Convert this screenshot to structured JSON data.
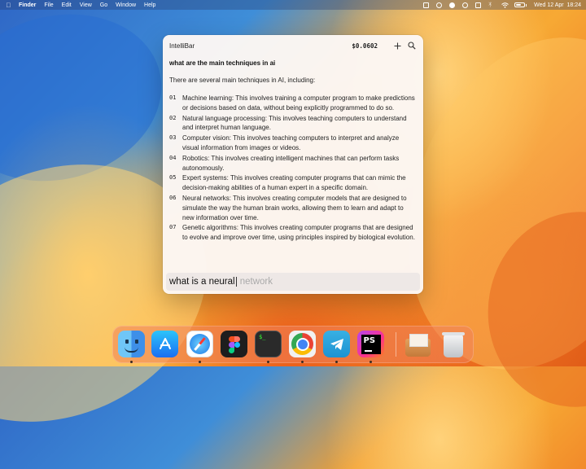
{
  "menubar": {
    "apple_icon": "apple-logo-icon",
    "app_name": "Finder",
    "menus": [
      "File",
      "Edit",
      "View",
      "Go",
      "Window",
      "Help"
    ],
    "status_icons": [
      "dropbox-icon",
      "record-icon",
      "brightness-icon",
      "circle-icon",
      "lock-icon",
      "bluetooth-icon",
      "wifi-icon",
      "battery-icon"
    ],
    "battery_level": 0.7,
    "clock": "Wed 12 Apr  18:24"
  },
  "window": {
    "title": "IntelliBar",
    "cost": "$0.0602",
    "add_icon": "plus-icon",
    "search_icon": "search-icon",
    "question": "what are the main techniques in ai",
    "intro": "There are several main techniques in AI, including:",
    "items": [
      {
        "num": "01",
        "text": "Machine learning: This involves training a computer program to make predictions or decisions based on data, without being explicitly programmed to do so."
      },
      {
        "num": "02",
        "text": "Natural language processing: This involves teaching computers to understand and interpret human language."
      },
      {
        "num": "03",
        "text": "Computer vision: This involves teaching computers to interpret and analyze visual information from images or videos."
      },
      {
        "num": "04",
        "text": "Robotics: This involves creating intelligent machines that can perform tasks autonomously."
      },
      {
        "num": "05",
        "text": "Expert systems: This involves creating computer programs that can mimic the decision-making abilities of a human expert in a specific domain."
      },
      {
        "num": "06",
        "text": "Neural networks: This involves creating computer models that are designed to simulate the way the human brain works, allowing them to learn and adapt to new information over time."
      },
      {
        "num": "07",
        "text": "Genetic algorithms: This involves creating computer programs that are designed to evolve and improve over time, using principles inspired by biological evolution."
      }
    ],
    "input": {
      "typed": "what is a neural",
      "suggestion": " network"
    }
  },
  "dock": {
    "apps": [
      {
        "name": "finder-icon",
        "running": true
      },
      {
        "name": "app-store-icon",
        "running": false
      },
      {
        "name": "safari-icon",
        "running": true
      },
      {
        "name": "figma-icon",
        "running": false
      },
      {
        "name": "terminal-icon",
        "running": true,
        "glyph": "$_"
      },
      {
        "name": "chrome-icon",
        "running": true
      },
      {
        "name": "telegram-icon",
        "running": true
      },
      {
        "name": "phpstorm-icon",
        "running": true,
        "glyph": "PS"
      }
    ],
    "extras": [
      {
        "name": "downloads-stack-icon"
      },
      {
        "name": "trash-icon"
      }
    ]
  }
}
